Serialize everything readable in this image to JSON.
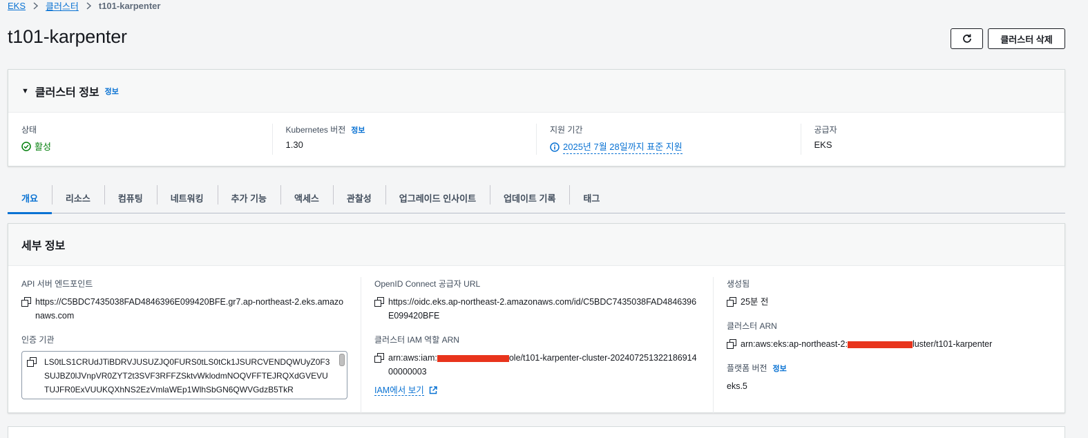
{
  "breadcrumb": {
    "items": [
      "EKS",
      "클러스터"
    ],
    "current": "t101-karpenter"
  },
  "header": {
    "title": "t101-karpenter",
    "delete_label": "클러스터 삭제"
  },
  "cluster_info": {
    "title": "클러스터 정보",
    "info_link": "정보",
    "status": {
      "label": "상태",
      "value": "활성"
    },
    "k8s_version": {
      "label": "Kubernetes 버전",
      "info_link": "정보",
      "value": "1.30"
    },
    "support": {
      "label": "지원 기간",
      "value": "2025년 7월 28일까지 표준 지원"
    },
    "provider": {
      "label": "공급자",
      "value": "EKS"
    }
  },
  "tabs": [
    "개요",
    "리소스",
    "컴퓨팅",
    "네트워킹",
    "추가 기능",
    "액세스",
    "관찰성",
    "업그레이드 인사이트",
    "업데이트 기록",
    "태그"
  ],
  "details": {
    "title": "세부 정보",
    "api_endpoint": {
      "label": "API 서버 엔드포인트",
      "value": "https://C5BDC7435038FAD4846396E099420BFE.gr7.ap-northeast-2.eks.amazonaws.com"
    },
    "cert_authority": {
      "label": "인증 기관",
      "value": "LS0tLS1CRUdJTiBDRVJUSUZJQ0FURS0tLS0tCk1JSURCVENDQWUyZ0F3SUJBZ0lJVnpVR0ZYT2t3SVF3RFFZSktvWklodmNOQVFFTEJRQXdGVEVUTUJFR0ExVUUKQXhNS2EzVmlaWEp1WlhSbGN6QWVGdzB5TkR"
    },
    "oidc": {
      "label": "OpenID Connect 공급자 URL",
      "value": "https://oidc.eks.ap-northeast-2.amazonaws.com/id/C5BDC7435038FAD4846396E099420BFE"
    },
    "iam_role": {
      "label": "클러스터 IAM 역할 ARN",
      "prefix": "arn:aws:iam:",
      "suffix": "ole/t101-karpenter-cluster-20240725132218691400000003",
      "view_link": "IAM에서 보기"
    },
    "created": {
      "label": "생성됨",
      "value": "25분 전"
    },
    "cluster_arn": {
      "label": "클러스터 ARN",
      "prefix": "arn:aws:eks:ap-northeast-2:",
      "suffix": "luster/t101-karpenter"
    },
    "platform_version": {
      "label": "플랫폼 버전",
      "info_link": "정보",
      "value": "eks.5"
    }
  },
  "colors": {
    "accent": "#0972d3",
    "success": "#037f0c",
    "redaction": "#e8341c"
  }
}
